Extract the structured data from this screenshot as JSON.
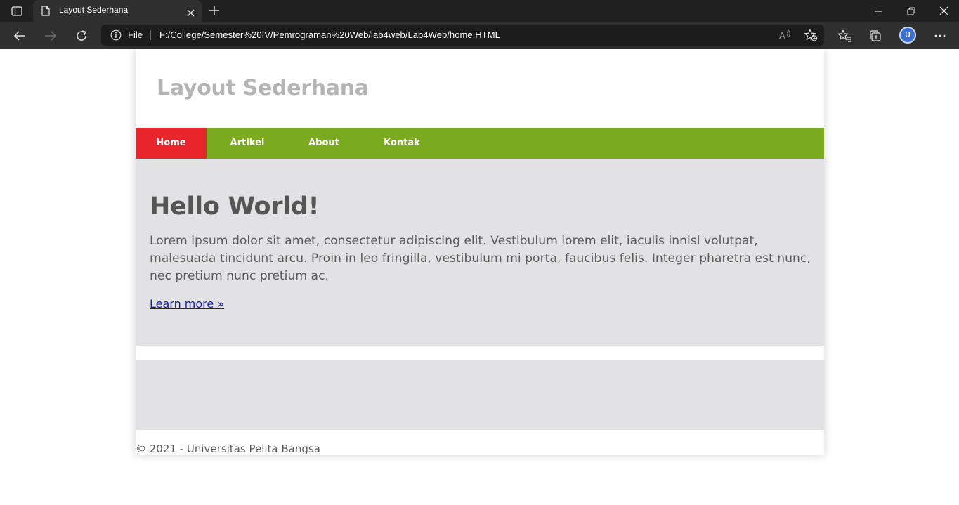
{
  "browser": {
    "tab_title": "Layout Sederhana",
    "address_scheme_label": "File",
    "url": "F:/College/Semester%20IV/Pemrograman%20Web/lab4web/Lab4Web/home.HTML",
    "profile_initial": "U"
  },
  "site": {
    "title": "Layout Sederhana",
    "nav": [
      {
        "label": "Home",
        "active": true
      },
      {
        "label": "Artikel",
        "active": false
      },
      {
        "label": "About",
        "active": false
      },
      {
        "label": "Kontak",
        "active": false
      }
    ],
    "hero": {
      "heading": "Hello World!",
      "body": "Lorem ipsum dolor sit amet, consectetur adipiscing elit. Vestibulum lorem elit, iaculis innisl volutpat, malesuada tincidunt arcu. Proin in leo fringilla, vestibulum mi porta, faucibus felis. Integer pharetra est nunc, nec pretium nunc pretium ac.",
      "link": "Learn more »"
    },
    "footer": "© 2021 - Universitas Pelita Bangsa"
  },
  "colors": {
    "nav_bg": "#7aab1e",
    "nav_active": "#e8252b",
    "hero_bg": "#e2e2e4",
    "title_color": "#b4b4b4"
  }
}
